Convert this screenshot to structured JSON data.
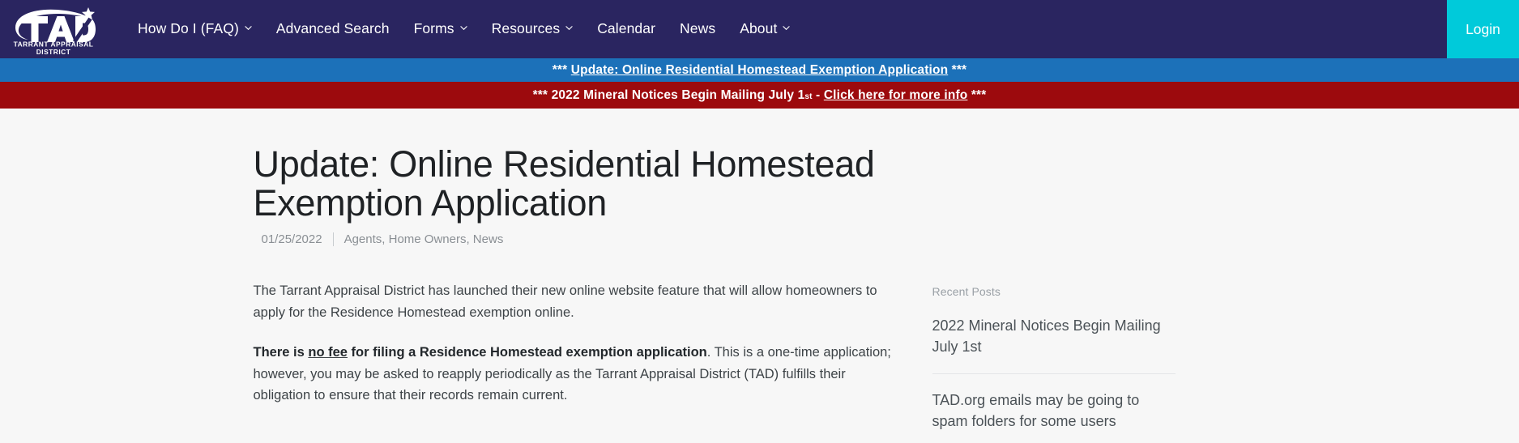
{
  "header": {
    "logo": {
      "mark": "TAD",
      "line1": "TARRANT APPRAISAL",
      "line2": "DISTRICT"
    },
    "nav": [
      {
        "label": "How Do I (FAQ)",
        "has_dropdown": true
      },
      {
        "label": "Advanced Search",
        "has_dropdown": false
      },
      {
        "label": "Forms",
        "has_dropdown": true
      },
      {
        "label": "Resources",
        "has_dropdown": true
      },
      {
        "label": "Calendar",
        "has_dropdown": false
      },
      {
        "label": "News",
        "has_dropdown": false
      },
      {
        "label": "About",
        "has_dropdown": true
      }
    ],
    "login_label": "Login",
    "bg_color": "#2a2560",
    "login_color": "#00cada"
  },
  "alerts": {
    "blue": {
      "prefix": "*** ",
      "link": "Update: Online Residential Homestead Exemption Application",
      "suffix": " ***",
      "bg_color": "#1c71b9"
    },
    "red": {
      "prefix": "*** 2022 Mineral Notices Begin Mailing July 1",
      "sup": "st",
      "middle": " - ",
      "link": "Click here for more info",
      "suffix": " ***",
      "bg_color": "#9c0a0d"
    }
  },
  "post": {
    "title": "Update: Online Residential Homestead Exemption Application",
    "date": "01/25/2022",
    "categories": "Agents, Home Owners, News",
    "paragraphs": [
      {
        "id": "p1",
        "parts": [
          {
            "text": "The Tarrant Appraisal District has launched their new online website feature that will allow homeowners to apply for the Residence Homestead exemption online.",
            "style": "normal"
          }
        ]
      },
      {
        "id": "p2",
        "parts": [
          {
            "text": "There is ",
            "style": "bold"
          },
          {
            "text": "no fee",
            "style": "bold-underline"
          },
          {
            "text": " for filing a Residence Homestead exemption application",
            "style": "bold"
          },
          {
            "text": ".  This is a one-time application; however, you may be asked to reapply periodically as the Tarrant Appraisal District (TAD) fulfills their obligation to ensure that their records remain current.",
            "style": "normal"
          }
        ]
      }
    ]
  },
  "sidebar": {
    "heading": "Recent Posts",
    "posts": [
      {
        "title": "2022 Mineral Notices Begin Mailing July 1st"
      },
      {
        "title": "TAD.org emails may be going to spam folders for some users"
      }
    ]
  }
}
